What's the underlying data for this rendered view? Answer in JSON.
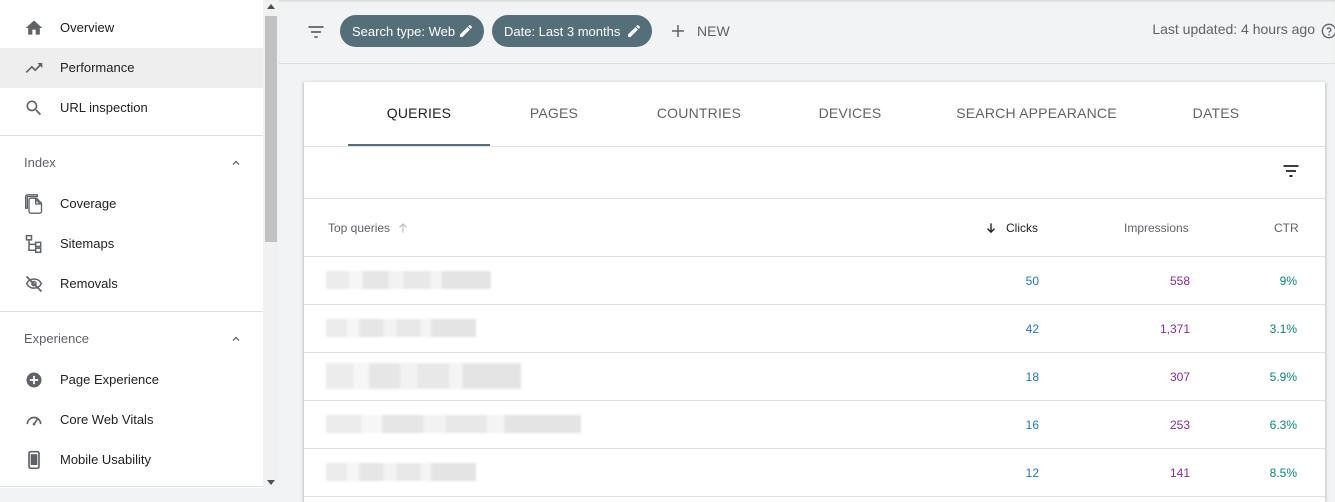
{
  "sidebar": {
    "items_top": [
      {
        "label": "Overview",
        "icon": "home-icon",
        "active": false
      },
      {
        "label": "Performance",
        "icon": "trending-up-icon",
        "active": true
      },
      {
        "label": "URL inspection",
        "icon": "search-icon",
        "active": false
      }
    ],
    "sections": [
      {
        "title": "Index",
        "items": [
          {
            "label": "Coverage",
            "icon": "copy-icon"
          },
          {
            "label": "Sitemaps",
            "icon": "sitemap-icon"
          },
          {
            "label": "Removals",
            "icon": "eye-off-icon"
          }
        ]
      },
      {
        "title": "Experience",
        "items": [
          {
            "label": "Page Experience",
            "icon": "add-circle-icon"
          },
          {
            "label": "Core Web Vitals",
            "icon": "speed-icon"
          },
          {
            "label": "Mobile Usability",
            "icon": "phone-icon"
          }
        ]
      }
    ]
  },
  "filterbar": {
    "chips": [
      {
        "label": "Search type: Web"
      },
      {
        "label": "Date: Last 3 months"
      }
    ],
    "new_label": "NEW",
    "last_updated": "Last updated: 4 hours ago"
  },
  "tabs": [
    {
      "label": "QUERIES",
      "active": true
    },
    {
      "label": "PAGES",
      "active": false
    },
    {
      "label": "COUNTRIES",
      "active": false
    },
    {
      "label": "DEVICES",
      "active": false
    },
    {
      "label": "SEARCH APPEARANCE",
      "active": false
    },
    {
      "label": "DATES",
      "active": false
    }
  ],
  "table": {
    "headers": {
      "queries": "Top queries",
      "clicks": "Clicks",
      "impressions": "Impressions",
      "ctr": "CTR"
    },
    "rows": [
      {
        "clicks": "50",
        "impressions": "558",
        "ctr": "9%"
      },
      {
        "clicks": "42",
        "impressions": "1,371",
        "ctr": "3.1%"
      },
      {
        "clicks": "18",
        "impressions": "307",
        "ctr": "5.9%"
      },
      {
        "clicks": "16",
        "impressions": "253",
        "ctr": "6.3%"
      },
      {
        "clicks": "12",
        "impressions": "141",
        "ctr": "8.5%"
      }
    ]
  },
  "colors": {
    "chip_bg": "#546e7a",
    "clicks": "#1a73e8",
    "impressions": "#8e24aa",
    "ctr": "#00897b"
  }
}
